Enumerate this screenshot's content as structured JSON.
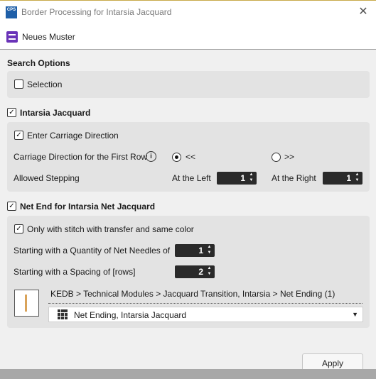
{
  "window": {
    "title": "Border Processing for Intarsia Jacquard",
    "app_icon_text": "CPS",
    "close_icon": "close-icon"
  },
  "pattern": {
    "label": "Neues Muster",
    "icon": "pattern-icon",
    "icon_color": "#6a33b8"
  },
  "search_options": {
    "heading": "Search Options",
    "selection": {
      "label": "Selection",
      "checked": false
    }
  },
  "intarsia": {
    "heading": "Intarsia Jacquard",
    "checked": true,
    "enter_carriage": {
      "label": "Enter Carriage Direction",
      "checked": true
    },
    "direction_label": "Carriage Direction for the First Row",
    "direction_left": "<<",
    "direction_right": ">>",
    "direction_selected": "<<",
    "stepping_label": "Allowed Stepping",
    "at_left_label": "At the Left",
    "at_left_value": "1",
    "at_right_label": "At the Right",
    "at_right_value": "1"
  },
  "net_end": {
    "heading": "Net End for Intarsia Net Jacquard",
    "checked": true,
    "only_stitch": {
      "label": "Only with stitch with transfer and same color",
      "checked": true
    },
    "quantity_label": "Starting with a Quantity of Net Needles of",
    "quantity_value": "1",
    "spacing_label": "Starting with a Spacing of [rows]",
    "spacing_value": "2",
    "breadcrumb": "KEDB > Technical Modules > Jacquard Transition, Intarsia > Net Ending (1)",
    "module_selected": "Net Ending, Intarsia Jacquard"
  },
  "footer": {
    "apply_label": "Apply"
  }
}
